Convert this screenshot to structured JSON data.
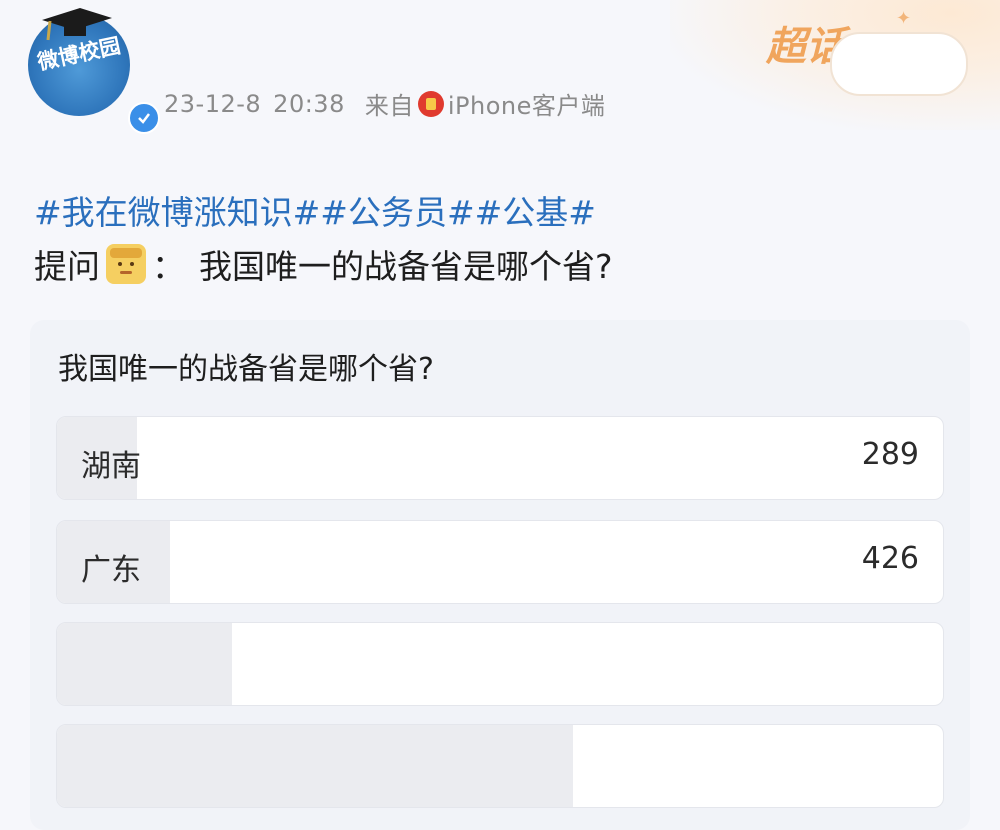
{
  "post": {
    "account_badge_text": "微博校园",
    "date": "23-12-8",
    "time": "20:38",
    "source_prefix": "来自",
    "source_app": "iPhone客户端",
    "super_topic_label": "超话"
  },
  "content": {
    "hashtags": "#我在微博涨知识##公务员##公基#",
    "question_prefix": "提问",
    "question_separator": "：",
    "question_text": "我国唯一的战备省是哪个省?"
  },
  "poll": {
    "title": "我国唯一的战备省是哪个省?",
    "options": [
      {
        "label": "湖南",
        "count": "289",
        "fill_fraction": 0.09
      },
      {
        "label": "广东",
        "count": "426",
        "fill_fraction": 0.128
      },
      {
        "label": "",
        "count": "",
        "fill_fraction": 0.198
      },
      {
        "label": "",
        "count": "",
        "fill_fraction": 0.582
      }
    ]
  },
  "colors": {
    "hashtag": "#2a6fbd",
    "poll_fill": "#ebecf0",
    "super_topic": "#f0a55d",
    "verified": "#3a8fe8"
  }
}
